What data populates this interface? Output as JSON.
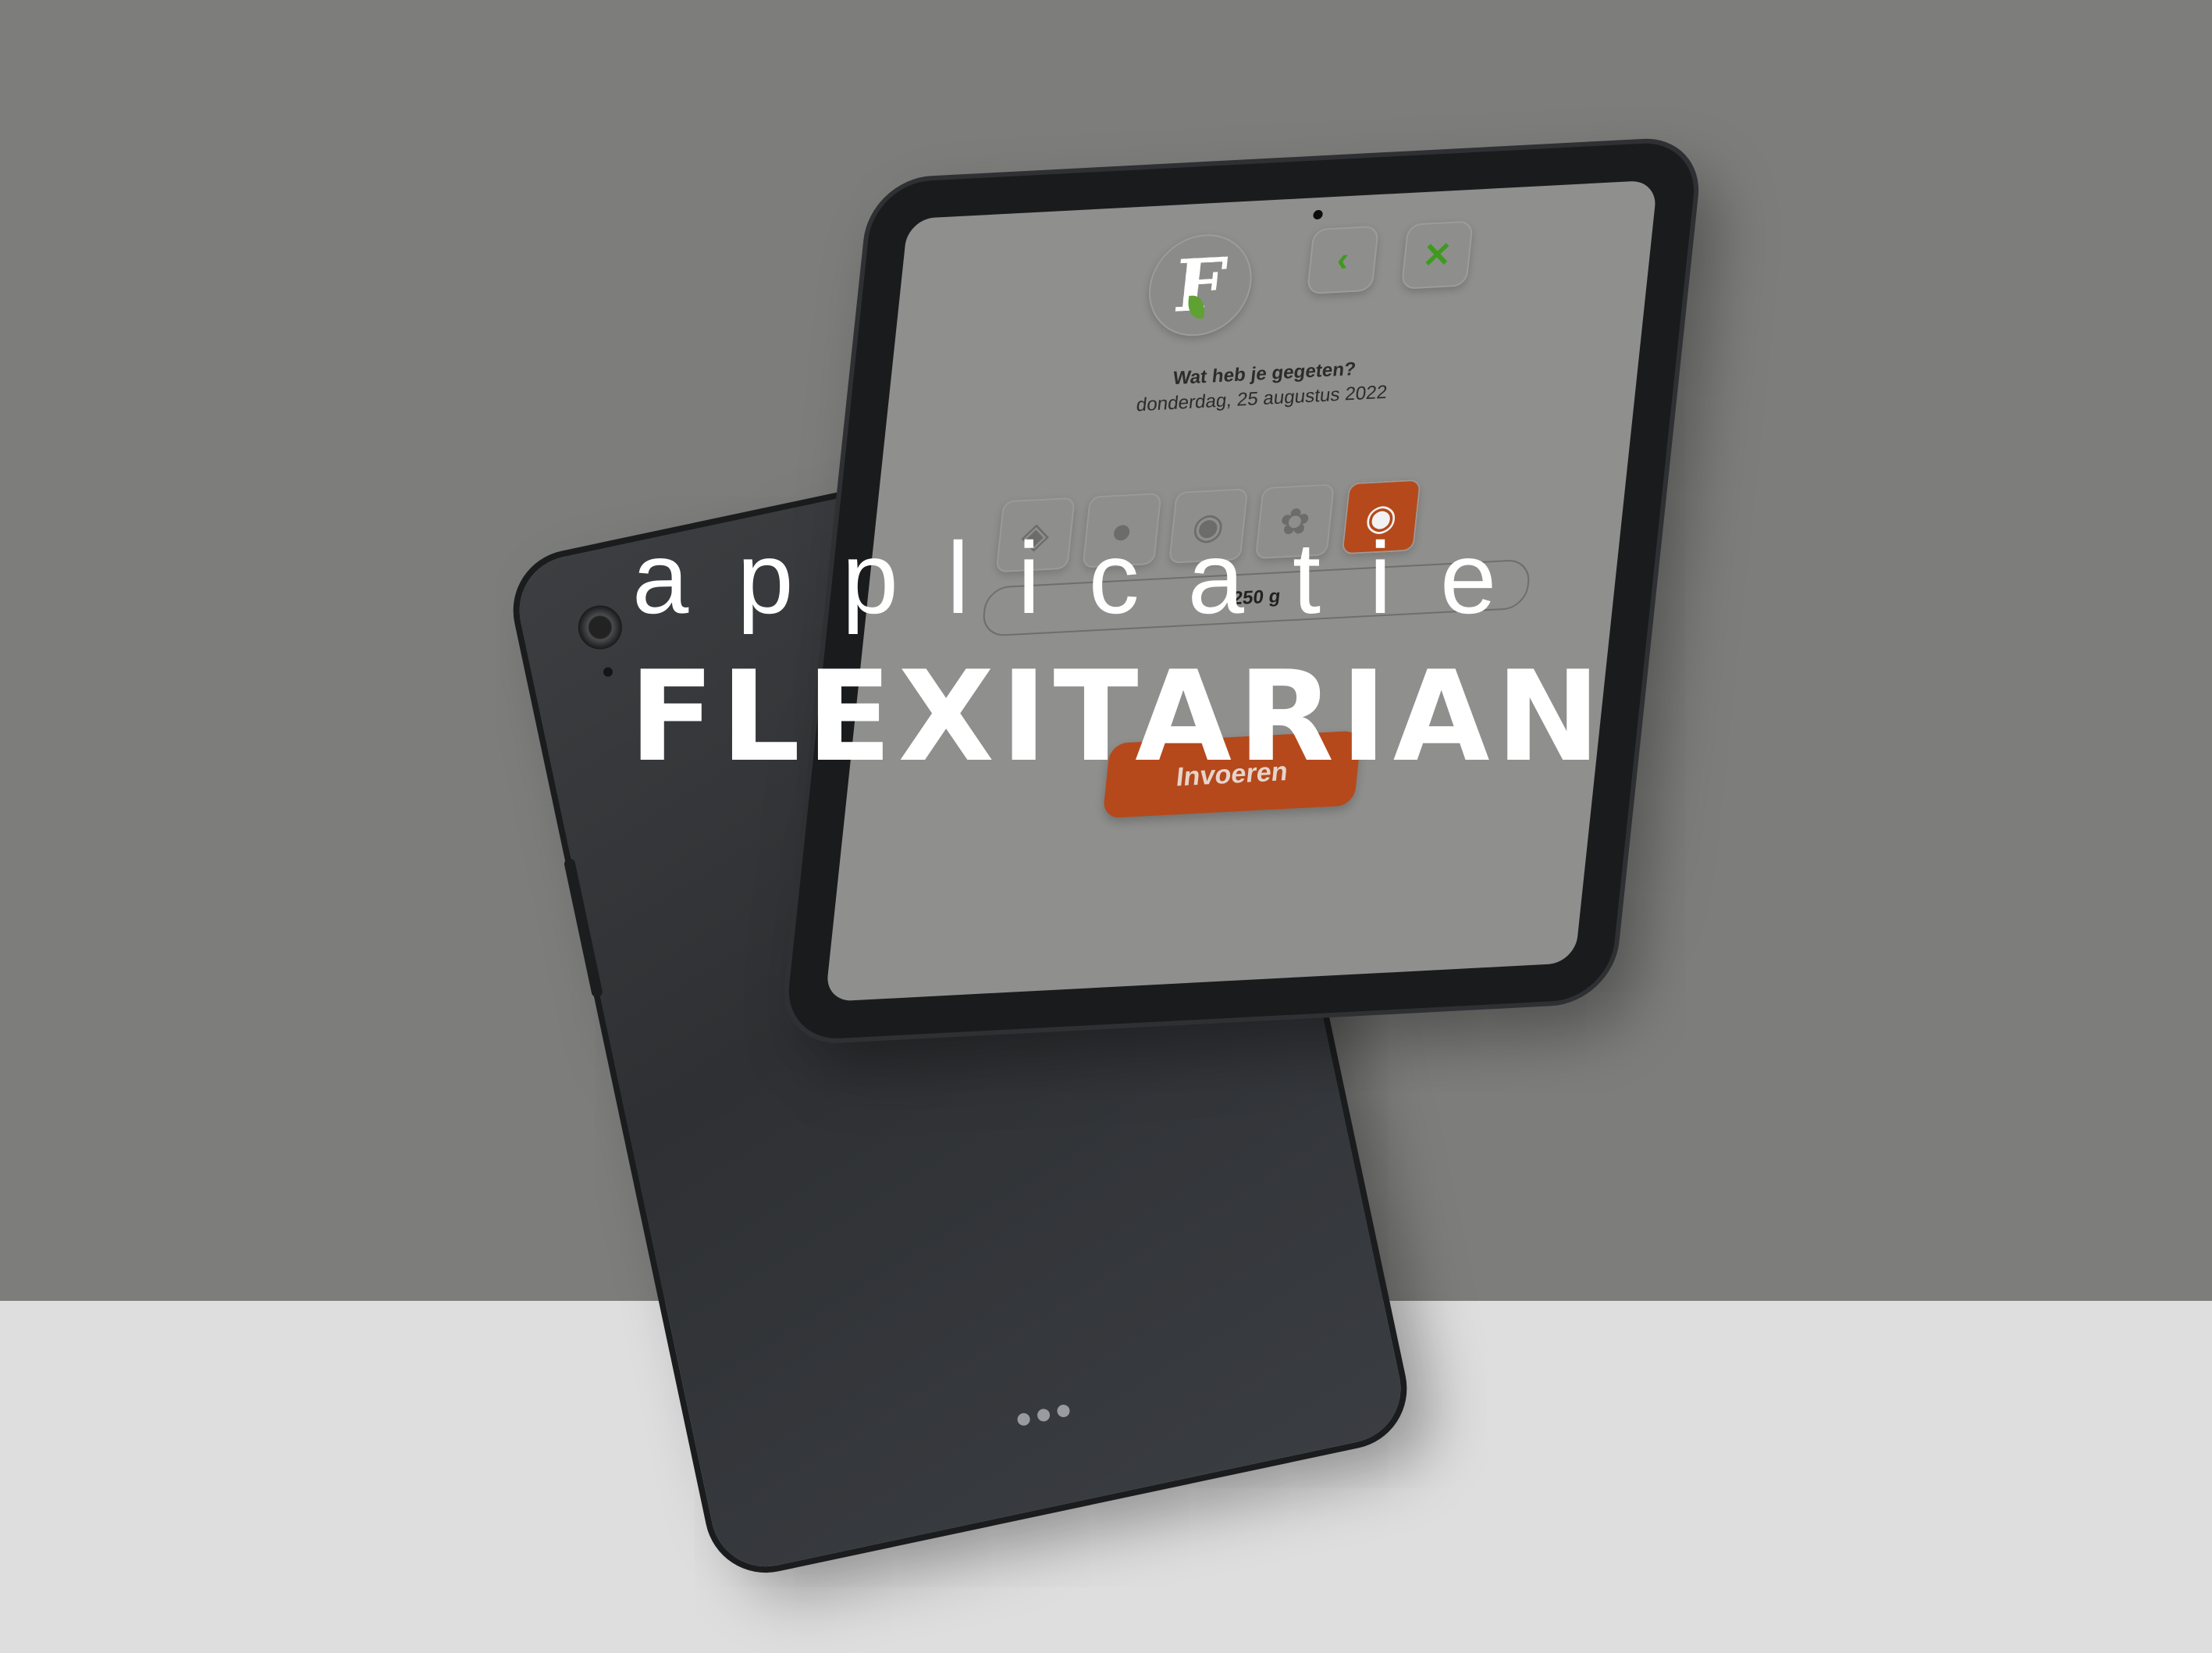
{
  "title": {
    "small": "applicatie",
    "big": "FLEXITARIAN"
  },
  "app": {
    "question": "Wat heb je gegeten?",
    "date": "donderdag, 25 augustus 2022",
    "amount": "250 g",
    "submit_label": "Invoeren",
    "nav": {
      "back_icon": "chevron-left",
      "close_icon": "close"
    },
    "categories": [
      {
        "name": "fish",
        "active": false
      },
      {
        "name": "chicken",
        "active": false
      },
      {
        "name": "pig",
        "active": false
      },
      {
        "name": "sheep",
        "active": false
      },
      {
        "name": "cow",
        "active": true
      }
    ]
  },
  "colors": {
    "accent": "#b5491b",
    "nav_icon": "#3f9a1f",
    "background_top": "#7d7d7b",
    "background_bottom": "#dedede"
  }
}
